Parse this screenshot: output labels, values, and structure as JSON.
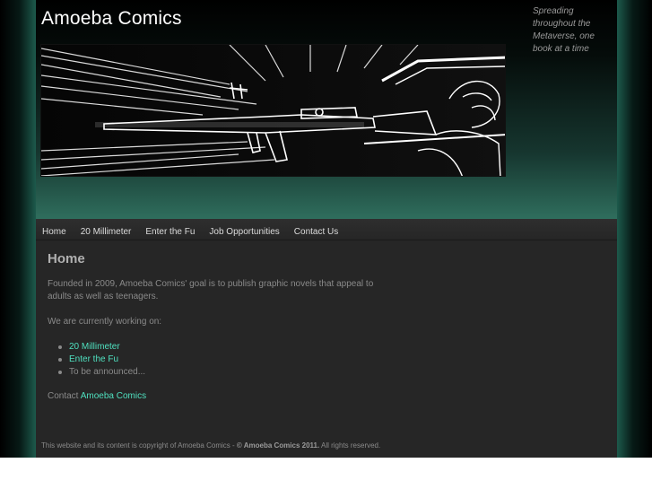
{
  "header": {
    "site_title": "Amoeba Comics",
    "tagline": "Spreading throughout the Metaverse, one book at a time"
  },
  "nav": {
    "items": [
      {
        "label": "Home"
      },
      {
        "label": "20 Millimeter"
      },
      {
        "label": "Enter the Fu"
      },
      {
        "label": "Job Opportunities"
      },
      {
        "label": "Contact Us"
      }
    ]
  },
  "content": {
    "heading": "Home",
    "intro": "Founded in 2009, Amoeba Comics' goal is to publish graphic novels that appeal to adults as well as teenagers.",
    "working_on": "We are currently working on:",
    "projects": [
      {
        "label": "20 Millimeter",
        "link": true
      },
      {
        "label": "Enter the Fu",
        "link": true
      },
      {
        "label": "To be announced...",
        "link": false
      }
    ],
    "contact_prefix": "Contact",
    "contact_link": "Amoeba Comics"
  },
  "footer": {
    "copyright_text": "This website and its content is copyright of Amoeba Comics -",
    "copyright_bold": "© Amoeba Comics 2011.",
    "rights": "All rights reserved."
  },
  "colors": {
    "link": "#4fe0bf",
    "page_bg": "#262626",
    "glow": "#1d5a4c"
  }
}
